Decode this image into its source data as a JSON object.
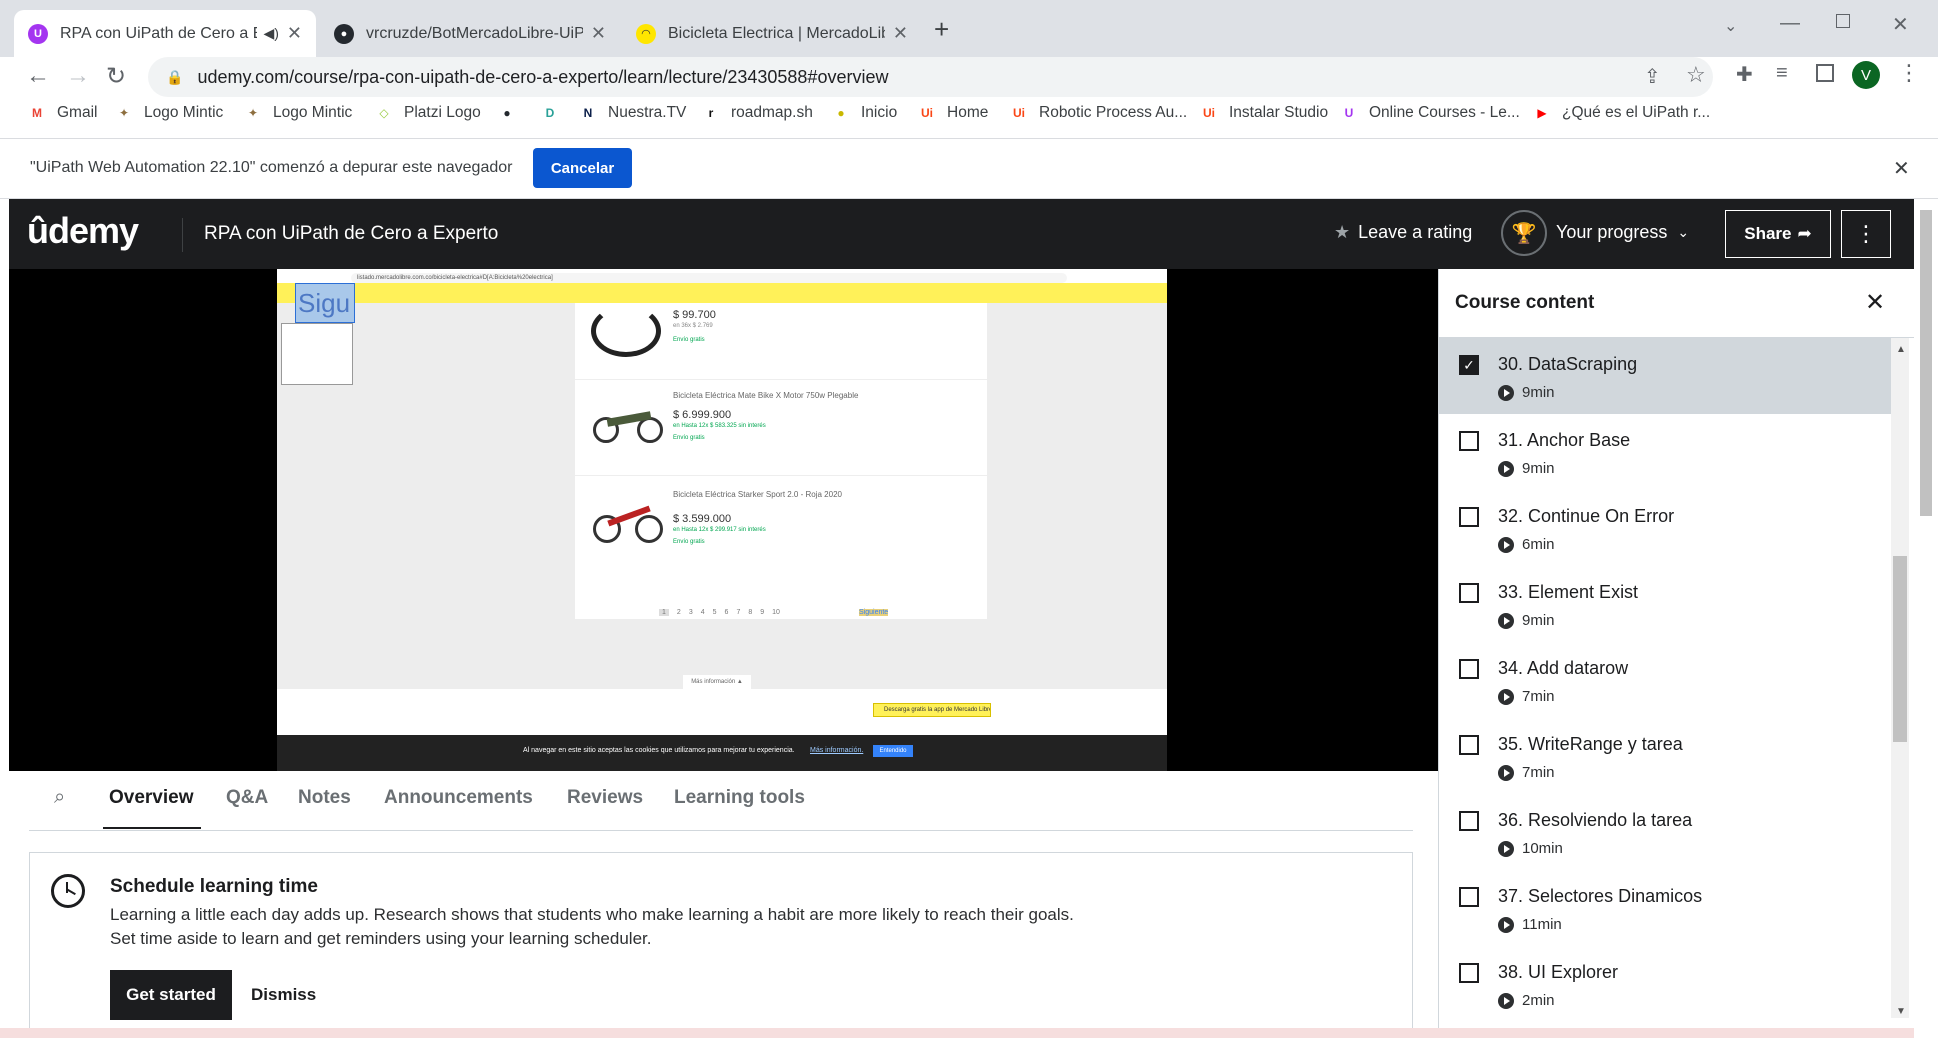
{
  "browser": {
    "tabs": [
      {
        "title": "RPA con UiPath de Cero a Ex",
        "color": "#a435f0",
        "active": true
      },
      {
        "title": "vrcruzde/BotMercadoLibre-UiPat",
        "color": "#24292f",
        "active": false
      },
      {
        "title": "Bicicleta Electrica | MercadoLibre",
        "color": "#ffe600",
        "active": false
      }
    ],
    "url": "udemy.com/course/rpa-con-uipath-de-cero-a-experto/learn/lecture/23430588#overview",
    "profile_initial": "V",
    "bookmarks": [
      {
        "label": "Gmail",
        "icon": "gmail-icon",
        "color": "#ea4335",
        "glyph": "M"
      },
      {
        "label": "Logo Mintic",
        "icon": "mintic-icon",
        "color": "#8d6e3f",
        "glyph": "✦"
      },
      {
        "label": "Logo Mintic",
        "icon": "mintic-icon",
        "color": "#8d6e3f",
        "glyph": "✦"
      },
      {
        "label": "Platzi Logo",
        "icon": "platzi-icon",
        "color": "#98ca3f",
        "glyph": "◇"
      },
      {
        "label": "",
        "icon": "github-icon",
        "color": "#24292f",
        "glyph": "●"
      },
      {
        "label": "",
        "icon": "bookmark-icon",
        "color": "#2aa198",
        "glyph": "D"
      },
      {
        "label": "Nuestra.TV",
        "icon": "nuestratv-icon",
        "color": "#0b1f4a",
        "glyph": "N"
      },
      {
        "label": "roadmap.sh",
        "icon": "roadmap-icon",
        "color": "#111",
        "glyph": "r"
      },
      {
        "label": "Inicio",
        "icon": "inicio-icon",
        "color": "#c9b800",
        "glyph": "●"
      },
      {
        "label": "Home",
        "icon": "uipath-icon",
        "color": "#fa4616",
        "glyph": "Ui"
      },
      {
        "label": "Robotic Process Au...",
        "icon": "uipath-icon",
        "color": "#fa4616",
        "glyph": "Ui"
      },
      {
        "label": "Instalar Studio",
        "icon": "uipath-icon",
        "color": "#fa4616",
        "glyph": "Ui"
      },
      {
        "label": "Online Courses - Le...",
        "icon": "udemy-icon",
        "color": "#a435f0",
        "glyph": "U"
      },
      {
        "label": "¿Qué es el UiPath r...",
        "icon": "youtube-icon",
        "color": "#ff0000",
        "glyph": "▶"
      }
    ]
  },
  "infobar": {
    "message": "\"UiPath Web Automation 22.10\" comenzó a depurar este navegador",
    "cancel_label": "Cancelar"
  },
  "header": {
    "logo": "ûdemy",
    "course_title": "RPA con UiPath de Cero a Experto",
    "rating_label": "Leave a rating",
    "progress_label": "Your progress",
    "share_label": "Share"
  },
  "video": {
    "sigu_text": "Sigu",
    "address": "listado.mercadolibre.com.co/bicicleta-electrica#D[A:Bicicleta%20electrica]",
    "products": [
      {
        "name": "",
        "price": "$ 99.700",
        "meta": "en 36x $ 2.769",
        "ship": "Envío gratis"
      },
      {
        "name": "Bicicleta Eléctrica Mate Bike X Motor 750w Plegable",
        "price": "$ 6.999.900",
        "meta": "en Hasta 12x $ 583.325 sin interés",
        "ship": "Envío gratis"
      },
      {
        "name": "Bicicleta Eléctrica Starker Sport 2.0 - Roja 2020",
        "price": "$ 3.599.000",
        "meta": "en Hasta 12x $ 299.917 sin interés",
        "ship": "Envío gratis"
      }
    ],
    "cookie_text": "Al navegar en este sitio aceptas las cookies que utilizamos para mejorar tu experiencia.",
    "cookie_link": "Más información.",
    "cookie_btn": "Entendido",
    "more_info": "Más información ▲",
    "app_banner": "Descarga gratis la app de Mercado Libre",
    "pages": [
      "1",
      "2",
      "3",
      "4",
      "5",
      "6",
      "7",
      "8",
      "9",
      "10"
    ],
    "next_label": "Siguiente"
  },
  "tabs": {
    "overview": "Overview",
    "qa": "Q&A",
    "notes": "Notes",
    "announcements": "Announcements",
    "reviews": "Reviews",
    "learning_tools": "Learning tools"
  },
  "schedule": {
    "title": "Schedule learning time",
    "line1": "Learning a little each day adds up. Research shows that students who make learning a habit are more likely to reach their goals.",
    "line2": "Set time aside to learn and get reminders using your learning scheduler.",
    "get_started": "Get started",
    "dismiss": "Dismiss"
  },
  "course_content": {
    "title": "Course content",
    "items": [
      {
        "title": "30. DataScraping",
        "duration": "9min",
        "checked": true,
        "current": true
      },
      {
        "title": "31. Anchor Base",
        "duration": "9min",
        "checked": false,
        "current": false
      },
      {
        "title": "32. Continue On Error",
        "duration": "6min",
        "checked": false,
        "current": false
      },
      {
        "title": "33. Element Exist",
        "duration": "9min",
        "checked": false,
        "current": false
      },
      {
        "title": "34. Add datarow",
        "duration": "7min",
        "checked": false,
        "current": false
      },
      {
        "title": "35. WriteRange y tarea",
        "duration": "7min",
        "checked": false,
        "current": false
      },
      {
        "title": "36. Resolviendo la tarea",
        "duration": "10min",
        "checked": false,
        "current": false
      },
      {
        "title": "37. Selectores Dinamicos",
        "duration": "11min",
        "checked": false,
        "current": false
      },
      {
        "title": "38. UI Explorer",
        "duration": "2min",
        "checked": false,
        "current": false
      }
    ]
  },
  "colors": {
    "udemy_purple": "#a435f0",
    "dark": "#1c1d1f",
    "chrome_blue": "#0b57d0"
  }
}
